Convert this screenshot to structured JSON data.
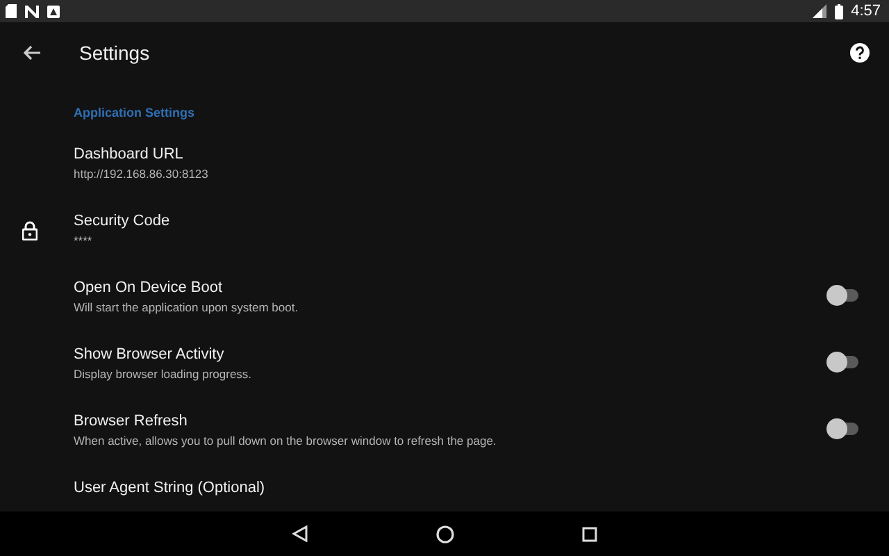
{
  "status_bar": {
    "time": "4:57"
  },
  "toolbar": {
    "title": "Settings"
  },
  "section": {
    "title": "Application Settings"
  },
  "items": [
    {
      "kind": "text",
      "title": "Dashboard URL",
      "summary": "http://192.168.86.30:8123"
    },
    {
      "kind": "secured",
      "title": "Security Code",
      "summary": "****"
    },
    {
      "kind": "switch",
      "title": "Open On Device Boot",
      "summary": "Will start the application upon system boot.",
      "on": false
    },
    {
      "kind": "switch",
      "title": "Show Browser Activity",
      "summary": "Display browser loading progress.",
      "on": false
    },
    {
      "kind": "switch",
      "title": "Browser Refresh",
      "summary": "When active, allows you to pull down on the browser window to refresh the page.",
      "on": false
    },
    {
      "kind": "text",
      "title": "User Agent String (Optional)"
    }
  ]
}
